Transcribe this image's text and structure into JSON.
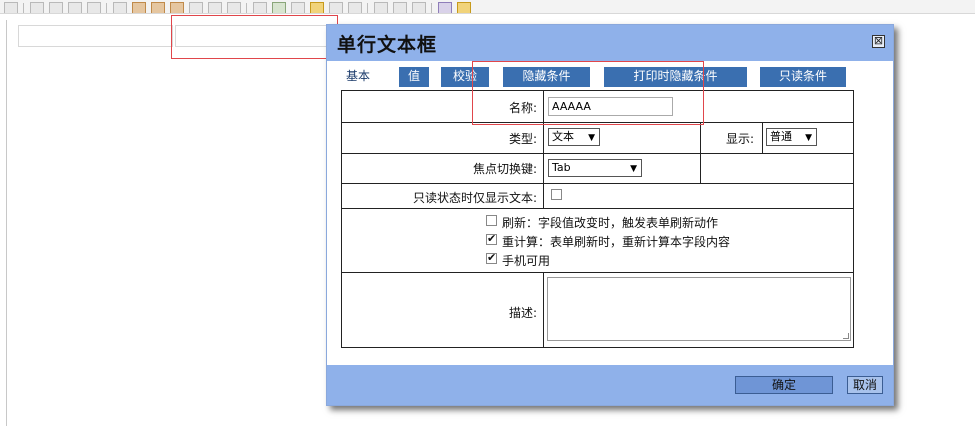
{
  "toolbar": {
    "icons": [
      "collapse-icon",
      "checkbox-icon",
      "radio-icon",
      "textfield-icon",
      "table-icon",
      "grid-icon",
      "table-red-icon",
      "tag-icon",
      "grid-orange-icon",
      "link-icon",
      "crop-icon",
      "layout-icon",
      "pencil-icon",
      "image-icon",
      "document-icon",
      "clipboard-icon",
      "picture-icon",
      "frame-icon",
      "globe-icon",
      "chain-icon",
      "unlink-icon",
      "anchor-icon",
      "font-color-icon",
      "highlight-icon"
    ]
  },
  "dialog": {
    "title": "单行文本框",
    "close_symbol": "⊠",
    "tabs": [
      {
        "label": "基本"
      },
      {
        "label": "值"
      },
      {
        "label": "校验"
      },
      {
        "label": "隐藏条件"
      },
      {
        "label": "打印时隐藏条件"
      },
      {
        "label": "只读条件"
      }
    ],
    "form": {
      "name_label": "名称:",
      "name_value": "AAAAA",
      "type_label": "类型:",
      "type_value": "文本",
      "display_label": "显示:",
      "display_value": "普通",
      "focus_label": "焦点切换键:",
      "focus_value": "Tab",
      "readonly_label": "只读状态时仅显示文本:",
      "refresh_label": "刷新：字段值改变时，触发表单刷新动作",
      "recalc_label": "重计算：表单刷新时，重新计算本字段内容",
      "mobile_label": "手机可用",
      "desc_label": "描述:"
    },
    "buttons": {
      "ok": "确定",
      "cancel": "取消"
    }
  },
  "colors": {
    "dialog_header": "#8fb1ea",
    "tab_bg": "#3a6fb0",
    "highlight_box": "#e0464b"
  }
}
